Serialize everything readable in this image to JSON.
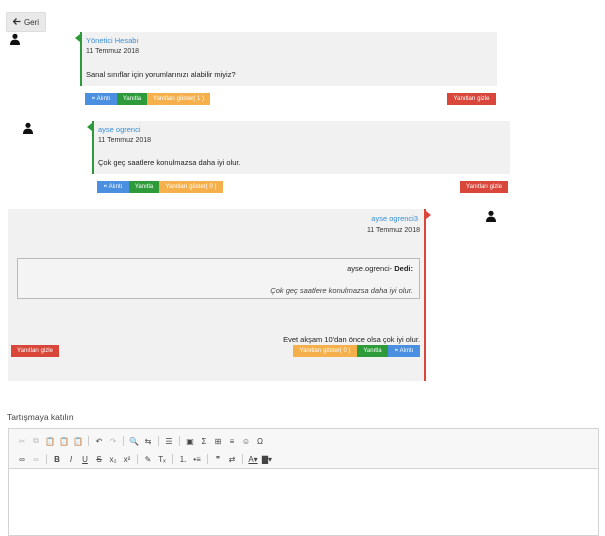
{
  "back_button": {
    "label": "Geri",
    "icon": "arrow-left-icon"
  },
  "comments": [
    {
      "author": "Yönetici Hesabı",
      "date": "11 Temmuz 2018",
      "message": "Sanal sınıflar için yorumlarınızı alabilir miyiz?",
      "actions": {
        "quote": "Alıntı",
        "reply": "Yanıtla",
        "show_replies": "Yanıtları göster( 1 )",
        "hide_replies": "Yanıtları gizle"
      }
    },
    {
      "author": "ayse ogrenci",
      "date": "11 Temmuz 2018",
      "message": "Çok geç saatlere konulmazsa daha iyi olur.",
      "actions": {
        "quote": "Alıntı",
        "reply": "Yanıtla",
        "show_replies": "Yanıtları göster( 0 )",
        "hide_replies": "Yanıtları gizle"
      }
    },
    {
      "author": "ayse ogrenci3",
      "date": "11 Temmuz 2018",
      "quote": {
        "author": "ayse.ogrenci-",
        "said": "Dedi:",
        "text": "Çok geç saatlere konulmazsa daha iyi olur."
      },
      "message": "Evet akşam 10'dan önce olsa çok iyi olur.",
      "actions": {
        "quote": "Alıntı",
        "reply": "Yanıtla",
        "show_replies": "Yanıtları göster( 0 )",
        "hide_replies": "Yanıtları gizle"
      }
    }
  ],
  "join": {
    "title": "Tartışmaya katılın"
  },
  "colors": {
    "blue": "#4a8fe0",
    "green": "#2e9b3a",
    "orange": "#f5b04c",
    "red": "#d9473b",
    "link": "#3a8fd6"
  }
}
